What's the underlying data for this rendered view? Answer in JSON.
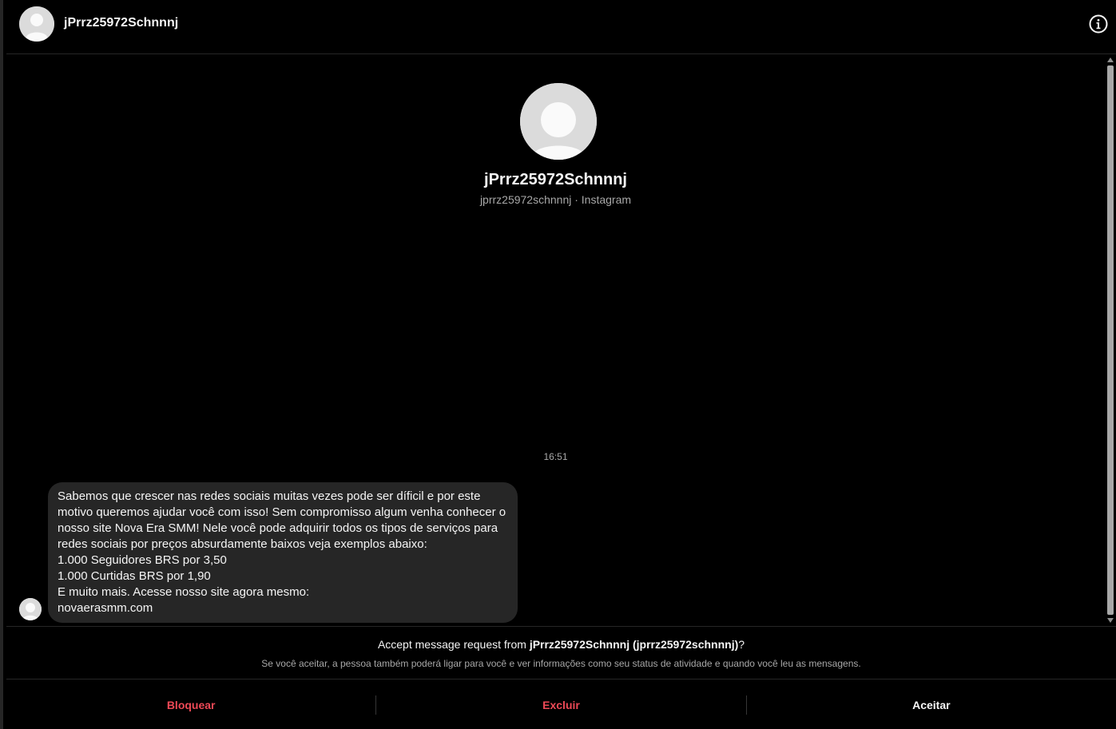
{
  "header": {
    "name": "jPrrz25972Schnnnj",
    "avatar_icon": "user-silhouette-icon",
    "info_icon": "info-icon"
  },
  "profile": {
    "name": "jPrrz25972Schnnnj",
    "subtitle": "jprrz25972schnnnj · Instagram"
  },
  "thread": {
    "timestamp": "16:51",
    "message_lines": [
      "Sabemos que crescer nas redes sociais muitas vezes pode ser díficil e por este",
      "motivo queremos ajudar você com isso! Sem compromisso algum venha conhecer o",
      "nosso site Nova Era SMM! Nele você pode adquirir todos os tipos de serviços para",
      "redes sociais por preços absurdamente baixos veja exemplos abaixo:",
      "1.000 Seguidores BRS por 3,50",
      "1.000 Curtidas BRS por 1,90",
      "E muito mais. Acesse nosso site agora mesmo:",
      "novaerasmm.com"
    ]
  },
  "request": {
    "title_prefix": "Accept message request from ",
    "title_bold": "jPrrz25972Schnnnj (jprrz25972schnnnj)",
    "title_suffix": "?",
    "note": "Se você aceitar, a pessoa também poderá ligar para você e ver informações como seu status de atividade e quando você leu as mensagens."
  },
  "actions": {
    "block": "Bloquear",
    "delete": "Excluir",
    "accept": "Aceitar"
  },
  "colors": {
    "background": "#000000",
    "bubble": "#262626",
    "danger": "#ed4956",
    "muted_text": "#a8a8a8"
  }
}
